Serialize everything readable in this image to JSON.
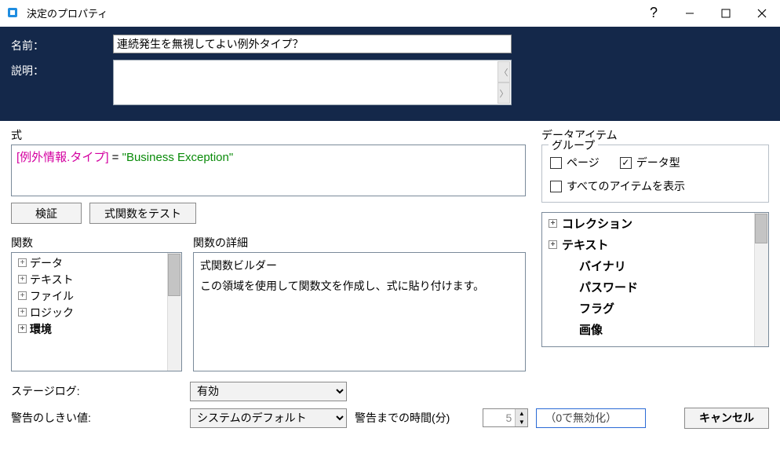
{
  "window": {
    "title": "決定のプロパティ",
    "help": "?",
    "minimize": "—",
    "maximize": "☐",
    "close": "✕"
  },
  "form": {
    "name_label": "名前：",
    "name_value": "連続発生を無視してよい例外タイプ？",
    "desc_label": "説明：",
    "desc_value": ""
  },
  "expr": {
    "section_label": "式",
    "bracket_open": "[",
    "token": "例外情報.タイプ",
    "bracket_close": "]",
    "operator": " = ",
    "string": "\"Business Exception\"",
    "validate_btn": "検証",
    "test_btn": "式関数をテスト"
  },
  "functions": {
    "label": "関数",
    "items": [
      "データ",
      "テキスト",
      "ファイル",
      "ロジック",
      "環境"
    ]
  },
  "funcdetail": {
    "label": "関数の詳細",
    "heading": "式関数ビルダー",
    "body": "この領域を使用して関数文を作成し、式に貼り付けます。"
  },
  "dataitems": {
    "section_label": "データアイテム",
    "group_label": "グループ",
    "chk_page": "ページ",
    "chk_datatype": "データ型",
    "chk_showall": "すべてのアイテムを表示",
    "tree": [
      {
        "label": "コレクション",
        "expand": true,
        "indent": false
      },
      {
        "label": "テキスト",
        "expand": true,
        "indent": false
      },
      {
        "label": "バイナリ",
        "expand": false,
        "indent": true
      },
      {
        "label": "パスワード",
        "expand": false,
        "indent": true
      },
      {
        "label": "フラグ",
        "expand": false,
        "indent": true
      },
      {
        "label": "画像",
        "expand": false,
        "indent": true
      }
    ]
  },
  "bottom": {
    "stagelog_label": "ステージログ:",
    "stagelog_value": "有効",
    "thresh_label": "警告のしきい値:",
    "thresh_value": "システムのデフォルト",
    "time_label": "警告までの時間(分)",
    "time_value": "5",
    "hint": "（0で無効化）",
    "cancel": "キャンセル"
  }
}
